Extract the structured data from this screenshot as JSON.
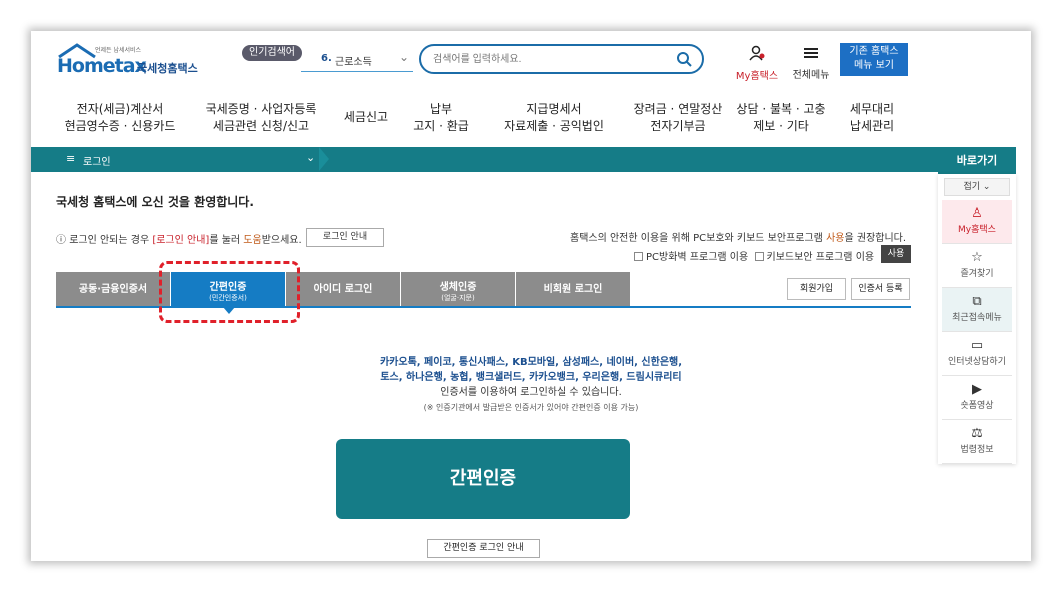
{
  "header": {
    "logo_brand": "Hometax",
    "logo_brand_ko": "국세청홈택스",
    "logo_tagline": "언제든 납세서비스",
    "popular_badge": "인기검색어",
    "popular_rank": "6.",
    "popular_text": "근로소득",
    "search_placeholder": "검색어를 입력하세요.",
    "my_hometax": "My홈택스",
    "all_menu": "전체메뉴",
    "old_hometax_line1": "기존 홈택스",
    "old_hometax_line2": "메뉴 보기"
  },
  "mainnav": [
    {
      "line1": "전자(세금)계산서",
      "line2": "현금영수증 · 신용카드"
    },
    {
      "line1": "국세증명 · 사업자등록",
      "line2": "세금관련 신청/신고"
    },
    {
      "line1": "세금신고",
      "line2": ""
    },
    {
      "line1": "납부",
      "line2": "고지 · 환급"
    },
    {
      "line1": "지급명세서",
      "line2": "자료제출 · 공익법인"
    },
    {
      "line1": "장려금 · 연말정산",
      "line2": "전자기부금"
    },
    {
      "line1": "상담 · 불복 · 고충",
      "line2": "제보 · 기타"
    },
    {
      "line1": "세무대리",
      "line2": "납세관리"
    }
  ],
  "breadcrumb": {
    "menu_icon": "≡",
    "label": "로그인",
    "chevron": "⌄"
  },
  "quick": {
    "title": "바로가기",
    "collapse": "접기 ⌄",
    "items": [
      {
        "icon": "person-icon",
        "label": "My홈택스"
      },
      {
        "icon": "star-icon",
        "label": "즐겨찾기"
      },
      {
        "icon": "recent-icon",
        "label": "최근접속메뉴"
      },
      {
        "icon": "monitor-icon",
        "label": "인터넷상담하기"
      },
      {
        "icon": "play-icon",
        "label": "숏폼영상"
      },
      {
        "icon": "gavel-icon",
        "label": "법령정보"
      }
    ]
  },
  "welcome": "국세청 홈택스에 오신 것을 환영합니다.",
  "login_help": {
    "prefix": "로그인 안되는 경우 ",
    "link": "[로그인 안내]",
    "mid": "를 눌러 ",
    "help": "도움",
    "suffix": "받으세요.",
    "button": "로그인 안내"
  },
  "security": {
    "note_prefix": "홈택스의 안전한 이용을 위해 PC보호와 키보드 보안프로그램 ",
    "note_highlight": "사용",
    "note_suffix": "을 권장합니다.",
    "opt1": "PC방화벽 프로그램 이용",
    "opt2": "키보드보안 프로그램 이용",
    "use_button": "사용"
  },
  "tabs": [
    {
      "main": "공동·금융인증서",
      "sub": ""
    },
    {
      "main": "간편인증",
      "sub": "(민간인증서)"
    },
    {
      "main": "아이디 로그인",
      "sub": ""
    },
    {
      "main": "생체인증",
      "sub": "(얼굴·지문)"
    },
    {
      "main": "비회원 로그인",
      "sub": ""
    }
  ],
  "join_button": "회원가입",
  "cert_button": "인증서 등록",
  "providers": {
    "line1": "카카오톡, 페이코, 통신사패스, KB모바일, 삼성패스, 네이버, 신한은행,",
    "line2": "토스, 하나은행, 농협, 뱅크샐러드, 카카오뱅크, 우리은행, 드림시큐리티",
    "line3": "인증서를 이용하여 로그인하실 수 있습니다.",
    "note": "(※ 인증기관에서 발급받은 인증서가 있어야 간편인증 이용 가능)"
  },
  "simple_auth_button": "간편인증",
  "simple_auth_guide": "간편인증 로그인 안내"
}
